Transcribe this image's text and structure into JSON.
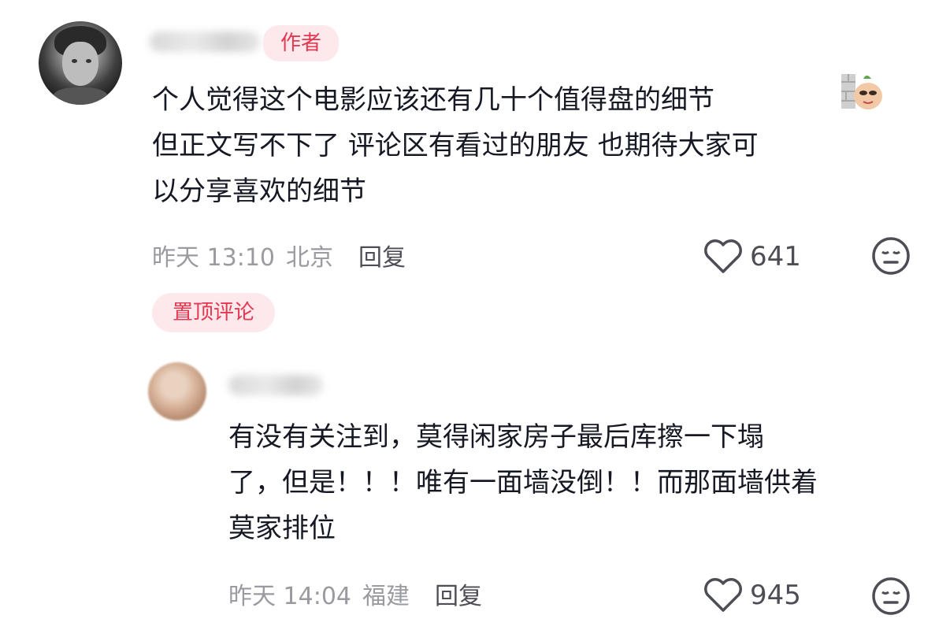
{
  "author_comment": {
    "badge": "作者",
    "text": "个人觉得这个电影应该还有几十个值得盘的细节\n但正文写不下了 评论区有看过的朋友 也期待大家可\n以分享喜欢的细节",
    "time": "昨天 13:10",
    "location": "北京",
    "reply_label": "回复",
    "likes": "641",
    "sticker": "peeking-doge-sticker"
  },
  "pinned_label": "置顶评论",
  "reply_comment": {
    "text": "有没有关注到，莫得闲家房子最后库擦一下塌\n了，但是！！！唯有一面墙没倒！！而那面墙供着\n莫家排位",
    "time": "昨天 14:04",
    "location": "福建",
    "reply_label": "回复",
    "likes": "945"
  },
  "colors": {
    "badge_bg": "#fde9ec",
    "badge_text": "#e5374f",
    "meta_text": "#9a9ba0",
    "body_text": "#161823"
  }
}
